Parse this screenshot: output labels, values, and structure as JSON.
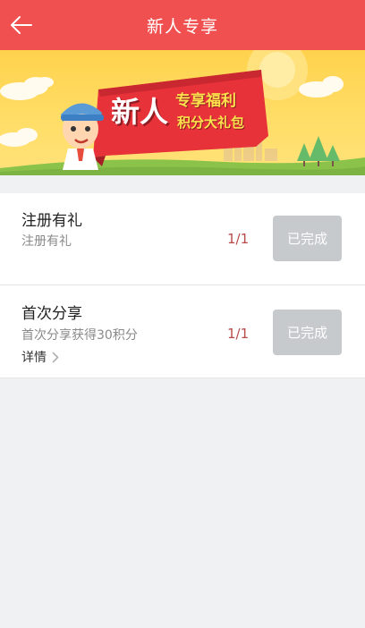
{
  "header": {
    "title": "新人专享",
    "back_icon": "arrow-left-icon",
    "background_color": "#f0504f"
  },
  "banner": {
    "headline_big": "新人",
    "headline_small": "专享福利",
    "subline": "积分大礼包",
    "ribbon_color": "#e8323a",
    "sky_color": "#ffd24d"
  },
  "tasks": [
    {
      "title": "注册有礼",
      "description": "注册有礼",
      "progress": "1/1",
      "button_label": "已完成"
    },
    {
      "title": "首次分享",
      "description": "首次分享获得30积分",
      "progress": "1/1",
      "button_label": "已完成",
      "detail_label": "详情",
      "detail_icon": "chevron-right-icon"
    }
  ],
  "colors": {
    "done_button": "#c6cacd",
    "progress_text": "#b94a4a",
    "page_background": "#f0f1f3"
  }
}
